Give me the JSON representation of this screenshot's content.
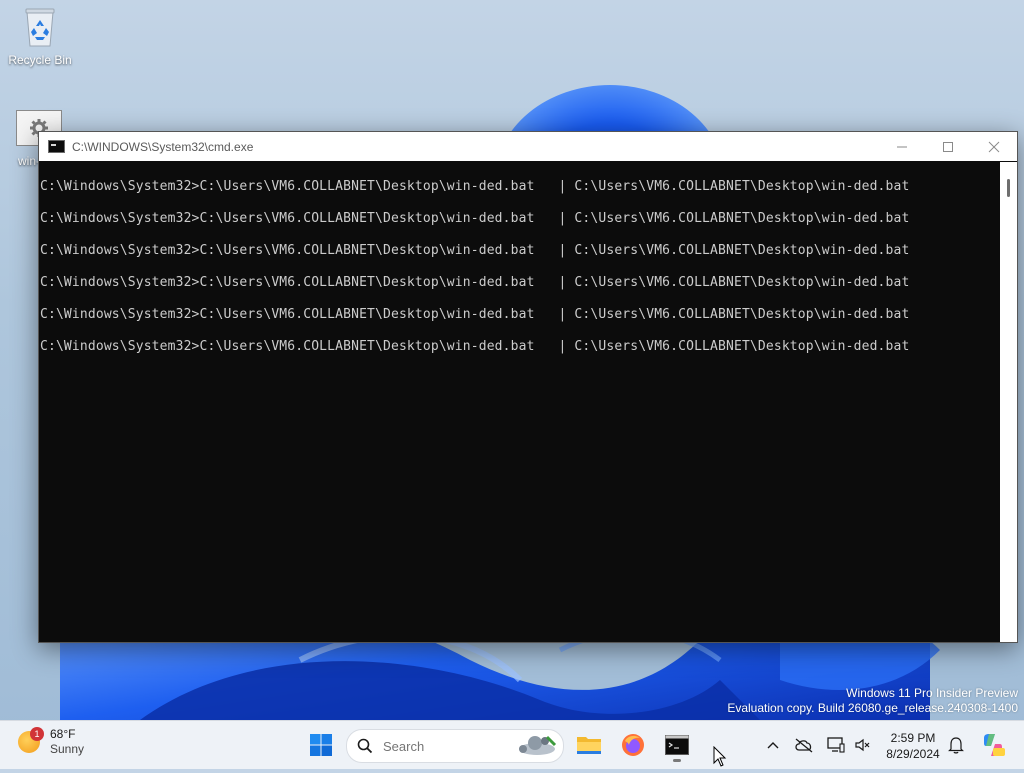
{
  "desktop": {
    "icons": [
      {
        "label": "Recycle Bin",
        "icon": "recycle-bin-icon"
      },
      {
        "label": "win-",
        "icon": "batch-file-gear-icon"
      }
    ]
  },
  "window": {
    "title": "C:\\WINDOWS\\System32\\cmd.exe",
    "controls": {
      "minimize": "minimize-icon",
      "maximize": "maximize-icon",
      "close": "close-icon"
    },
    "console_lines": [
      "C:\\Windows\\System32>C:\\Users\\VM6.COLLABNET\\Desktop\\win-ded.bat   | C:\\Users\\VM6.COLLABNET\\Desktop\\win-ded.bat",
      "C:\\Windows\\System32>C:\\Users\\VM6.COLLABNET\\Desktop\\win-ded.bat   | C:\\Users\\VM6.COLLABNET\\Desktop\\win-ded.bat",
      "C:\\Windows\\System32>C:\\Users\\VM6.COLLABNET\\Desktop\\win-ded.bat   | C:\\Users\\VM6.COLLABNET\\Desktop\\win-ded.bat",
      "C:\\Windows\\System32>C:\\Users\\VM6.COLLABNET\\Desktop\\win-ded.bat   | C:\\Users\\VM6.COLLABNET\\Desktop\\win-ded.bat",
      "C:\\Windows\\System32>C:\\Users\\VM6.COLLABNET\\Desktop\\win-ded.bat   | C:\\Users\\VM6.COLLABNET\\Desktop\\win-ded.bat",
      "C:\\Windows\\System32>C:\\Users\\VM6.COLLABNET\\Desktop\\win-ded.bat   | C:\\Users\\VM6.COLLABNET\\Desktop\\win-ded.bat"
    ]
  },
  "watermark": {
    "line1": "Windows 11 Pro Insider Preview",
    "line2": "Evaluation copy. Build 26080.ge_release.240308-1400"
  },
  "taskbar": {
    "weather": {
      "temp": "68°F",
      "condition": "Sunny",
      "badge": "1"
    },
    "search": {
      "placeholder": "Search"
    },
    "apps": [
      "start-icon",
      "file-explorer-icon",
      "firefox-icon",
      "terminal-icon"
    ],
    "tray": {
      "time": "2:59 PM",
      "date": "8/29/2024"
    }
  },
  "colors": {
    "console_bg": "#0c0c0c",
    "console_text": "#cccccc",
    "taskbar_bg": "#eef2f7",
    "accent": "#0067c0"
  }
}
